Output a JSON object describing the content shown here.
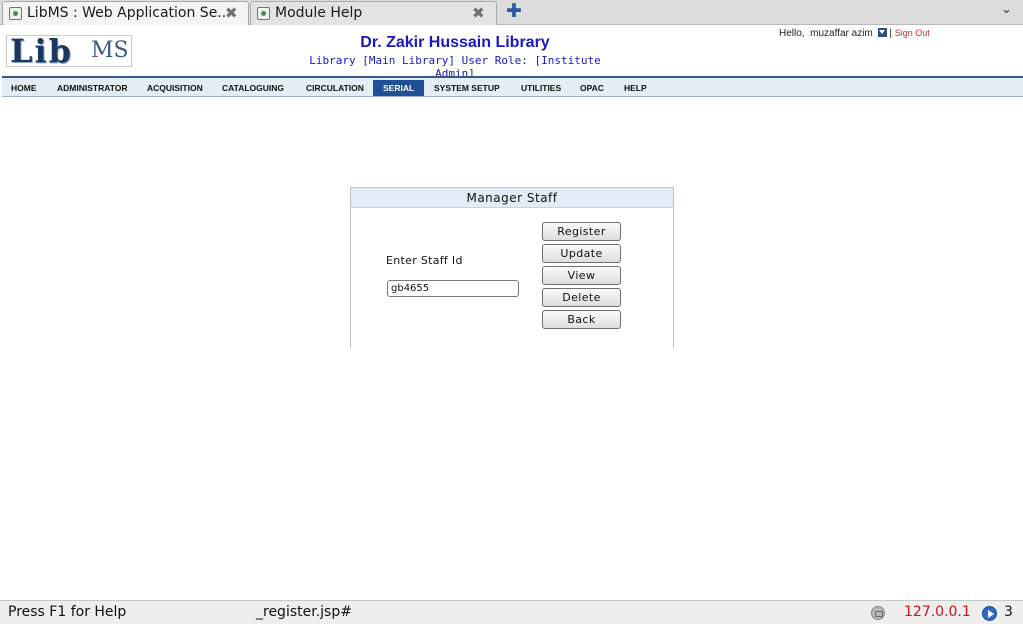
{
  "browser": {
    "tabs": [
      {
        "title": "LibMS : Web Application Se...",
        "active": true
      },
      {
        "title": "Module Help",
        "active": false
      }
    ],
    "close_glyph": "✖",
    "newtab_glyph": "✚",
    "tablist_glyph": "⌄"
  },
  "header": {
    "logo_lib": "Lib",
    "logo_ms": "MS",
    "library_name": "Dr. Zakir Hussain Library",
    "library_sub": "Library [Main Library]  User Role: [Institute Admin]",
    "greeting": "Hello,",
    "user_name": "muzaffar azim",
    "separator": "|",
    "sign_out": "Sign Out"
  },
  "nav": {
    "items": [
      {
        "label": "HOME",
        "active": false
      },
      {
        "label": "ADMINISTRATOR",
        "active": false
      },
      {
        "label": "ACQUISITION",
        "active": false
      },
      {
        "label": "CATALOGUING",
        "active": false
      },
      {
        "label": "CIRCULATION",
        "active": false
      },
      {
        "label": "SERIAL",
        "active": true
      },
      {
        "label": "SYSTEM SETUP",
        "active": false
      },
      {
        "label": "UTILITIES",
        "active": false
      },
      {
        "label": "OPAC",
        "active": false
      },
      {
        "label": "HELP",
        "active": false
      }
    ]
  },
  "panel": {
    "title": "Manager Staff",
    "staff_label": "Enter Staff Id",
    "staff_value": "gb4655",
    "buttons": {
      "register": "Register",
      "update": "Update",
      "view": "View",
      "delete": "Delete",
      "back": "Back"
    }
  },
  "status": {
    "help_text": "Press F1 for Help",
    "url": "_register.jsp#",
    "ip": "127.0.0.1",
    "count": "3"
  },
  "colors": {
    "nav_active": "#1f4f96",
    "title_blue": "#1a1ac0",
    "sign_out_red": "#c03030",
    "ip_red": "#c01818"
  }
}
